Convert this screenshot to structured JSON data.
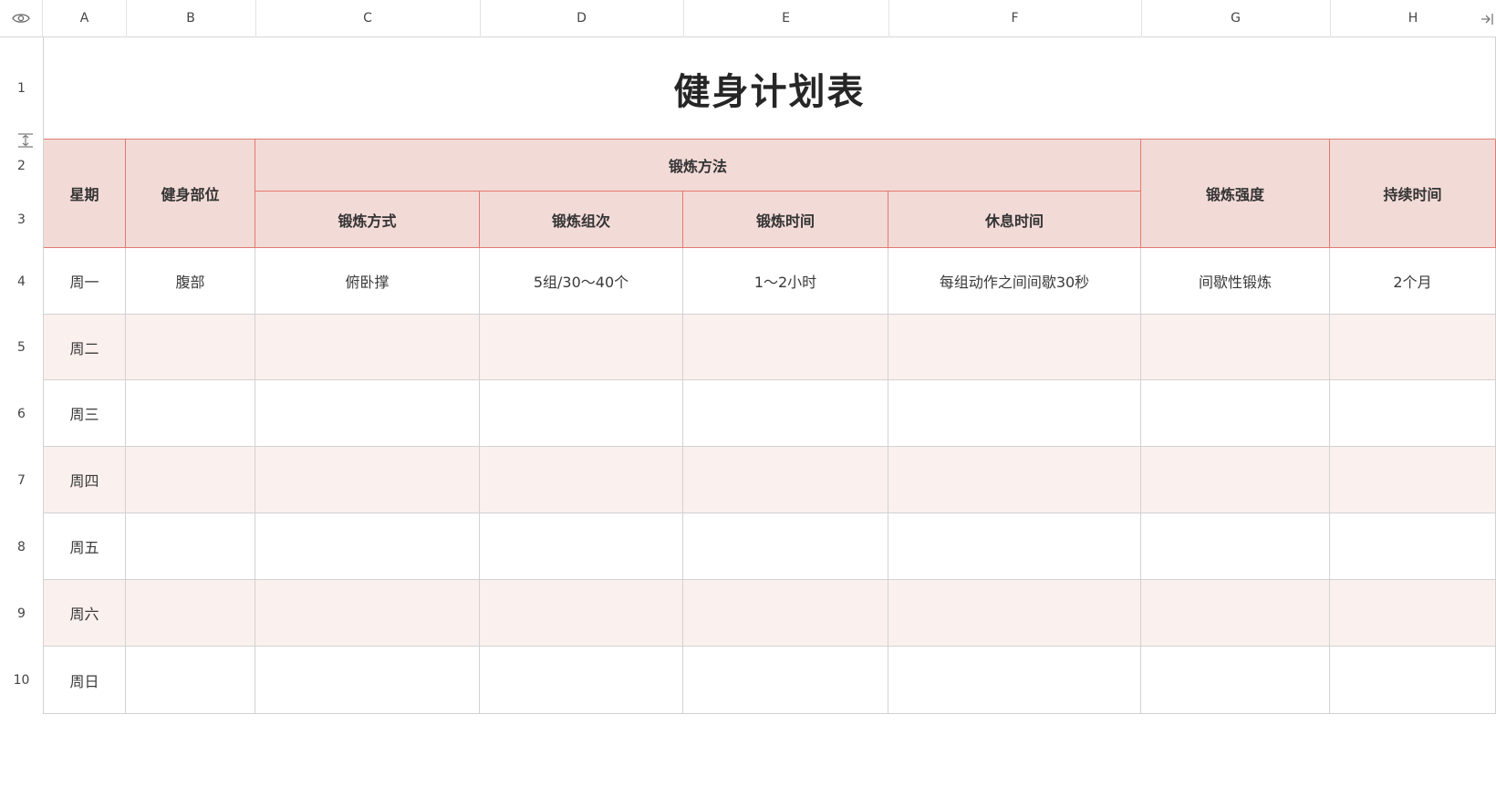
{
  "sheet": {
    "columns": [
      "A",
      "B",
      "C",
      "D",
      "E",
      "F",
      "G",
      "H"
    ],
    "rows": [
      "1",
      "2",
      "3",
      "4",
      "5",
      "6",
      "7",
      "8",
      "9",
      "10"
    ],
    "title": "健身计划表",
    "header": {
      "day": "星期",
      "body_part": "健身部位",
      "method_group": "锻炼方法",
      "method": "锻炼方式",
      "sets": "锻炼组次",
      "time": "锻炼时间",
      "rest": "休息时间",
      "intensity": "锻炼强度",
      "duration": "持续时间"
    },
    "days": [
      "周一",
      "周二",
      "周三",
      "周四",
      "周五",
      "周六",
      "周日"
    ],
    "row1": {
      "body_part": "腹部",
      "method": "俯卧撑",
      "sets": "5组/30～40个",
      "time": "1～2小时",
      "rest": "每组动作之间间歇30秒",
      "intensity": "间歇性锻炼",
      "duration": "2个月"
    }
  },
  "colors": {
    "header_bg": "#f2dad7",
    "header_border": "#e07a6f",
    "alt_row": "#faf0ed"
  },
  "icons": {
    "corner": "eye-icon",
    "row_resize": "row-resize-icon",
    "collapse": "collapse-panel-icon"
  }
}
